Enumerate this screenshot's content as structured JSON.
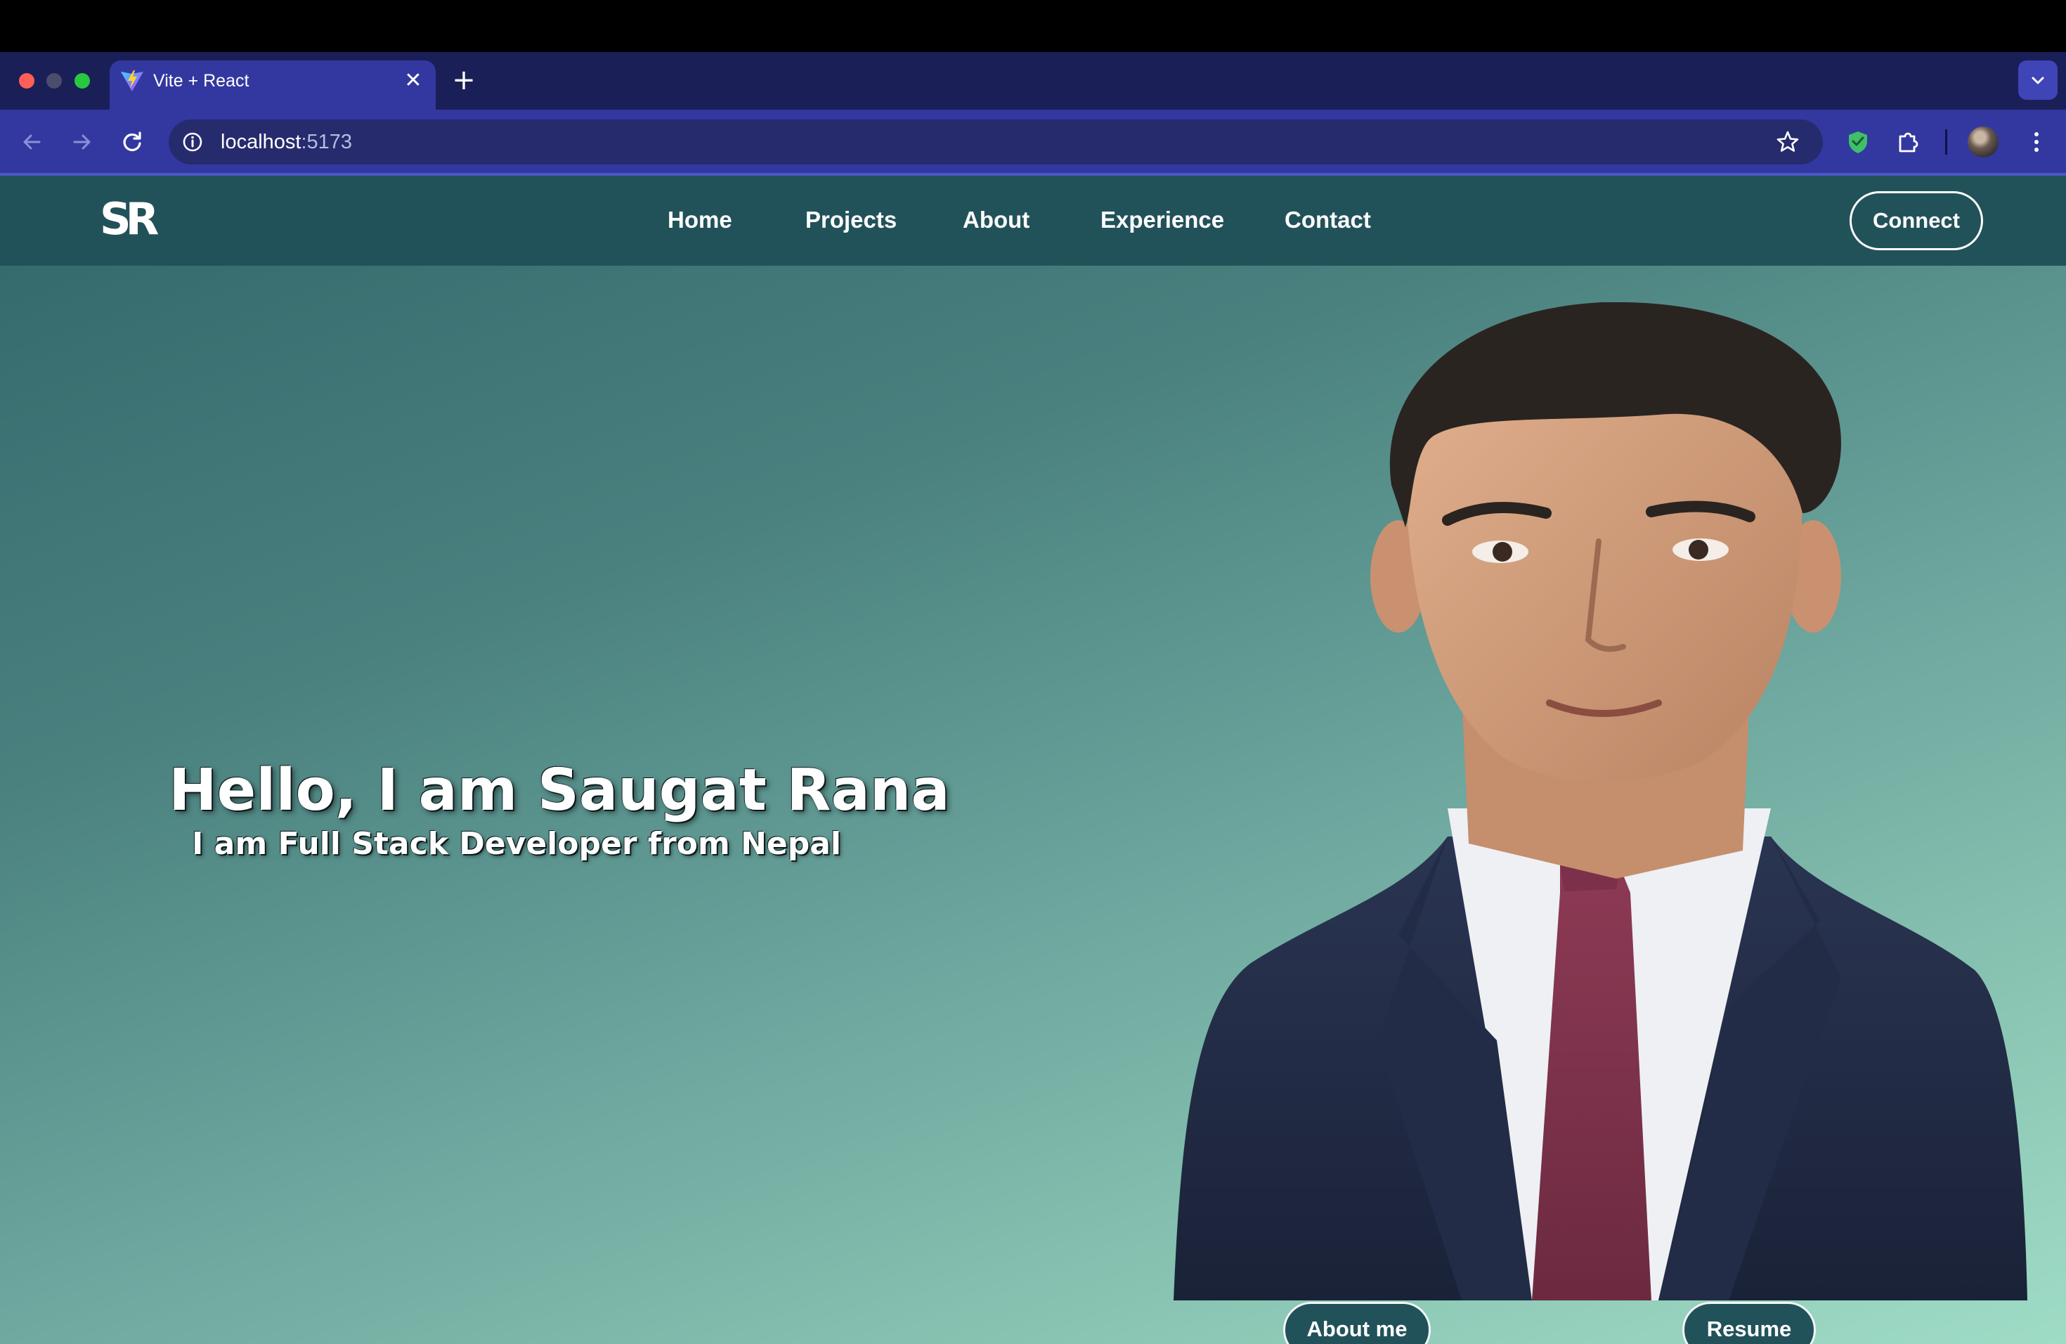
{
  "browser": {
    "tab": {
      "title": "Vite + React",
      "close_glyph": "✕",
      "favicon": "vite-icon"
    },
    "new_tab_glyph": "+",
    "address": {
      "host": "localhost",
      "port": ":5173"
    },
    "icons": [
      "back-arrow-icon",
      "forward-arrow-icon",
      "reload-icon",
      "site-info-icon",
      "star-icon",
      "shield-extension-icon",
      "puzzle-extensions-icon",
      "profile-avatar",
      "kebab-menu-icon",
      "tab-search-chevron-icon"
    ],
    "colors": {
      "tabbar": "#1b1f58",
      "toolbar": "#3338a0",
      "omnibox": "#262b6e"
    }
  },
  "site": {
    "logo": "SR",
    "nav": {
      "home": "Home",
      "projects": "Projects",
      "about": "About",
      "experience": "Experience",
      "contact": "Contact"
    },
    "connect_label": "Connect",
    "hero": {
      "title": "Hello, I am Saugat Rana",
      "subtitle": "I am Full Stack Developer from Nepal"
    },
    "buttons": {
      "about": "About me",
      "resume": "Resume"
    },
    "colors": {
      "navbar": "#225259",
      "gradient_start": "#32676a",
      "gradient_end": "#9fdcc6",
      "button": "#225259"
    }
  }
}
